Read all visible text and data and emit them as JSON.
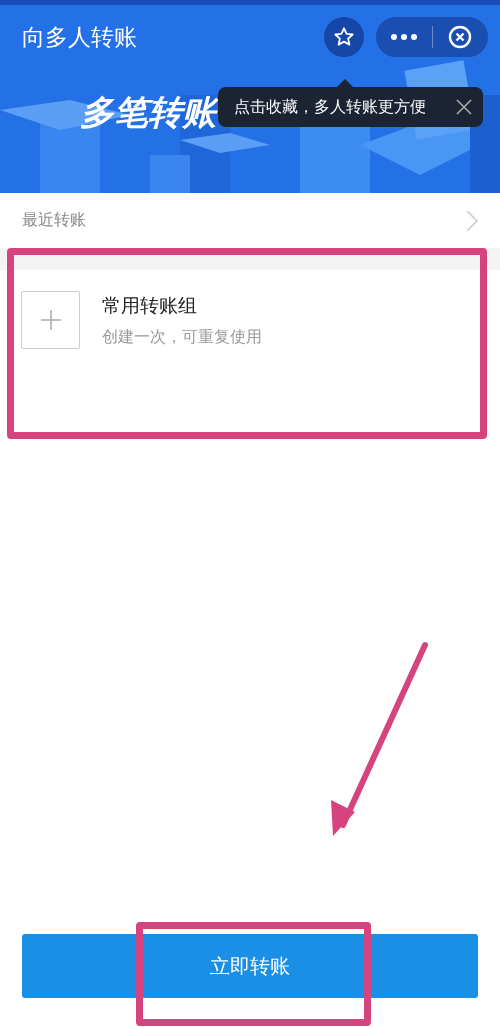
{
  "header": {
    "title": "向多人转账",
    "banner_title": "多笔转账"
  },
  "tooltip": {
    "text": "点击收藏，多人转账更方便"
  },
  "recent": {
    "label": "最近转账"
  },
  "group": {
    "title": "常用转账组",
    "subtitle": "创建一次，可重复使用"
  },
  "primary_button": {
    "label": "立即转账"
  }
}
